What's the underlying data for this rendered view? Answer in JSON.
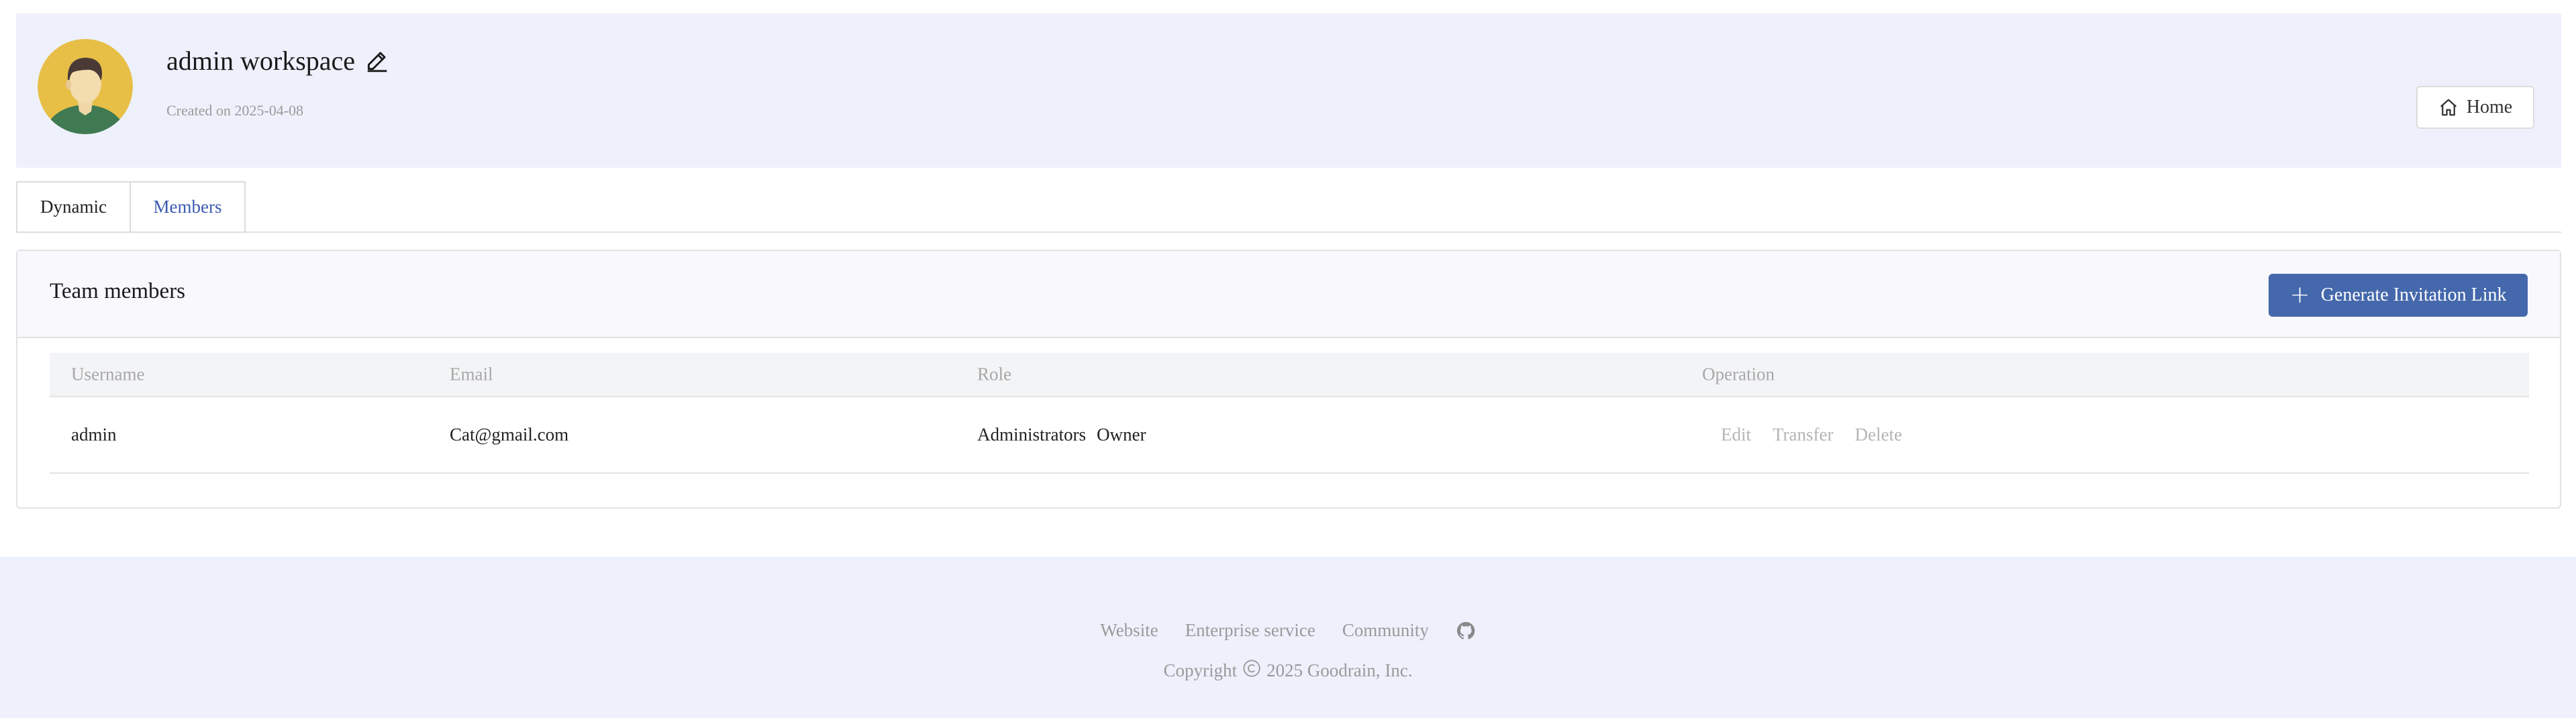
{
  "workspace": {
    "name": "admin workspace",
    "created": "Created on 2025-04-08"
  },
  "header": {
    "home_label": "Home"
  },
  "tabs": [
    {
      "label": "Dynamic",
      "active": false
    },
    {
      "label": "Members",
      "active": true
    }
  ],
  "panel": {
    "title": "Team members",
    "invite_label": "Generate Invitation Link"
  },
  "table": {
    "columns": [
      "Username",
      "Email",
      "Role",
      "Operation"
    ],
    "rows": [
      {
        "username": "admin",
        "email": "Cat@gmail.com",
        "roles": [
          "Administrators",
          "Owner"
        ],
        "ops": [
          "Edit",
          "Transfer",
          "Delete"
        ]
      }
    ]
  },
  "footer": {
    "links": [
      "Website",
      "Enterprise service",
      "Community"
    ],
    "copyright_prefix": "Copyright",
    "copyright_text": "2025 Goodrain, Inc."
  },
  "colors": {
    "accent": "#4468ab",
    "header_bg": "#eef1fc",
    "active_tab": "#3b5bb0",
    "muted": "#9a9a9a"
  },
  "icons": [
    "user-avatar",
    "edit-icon",
    "home-icon",
    "plus-icon",
    "github-icon",
    "copyright-icon"
  ]
}
